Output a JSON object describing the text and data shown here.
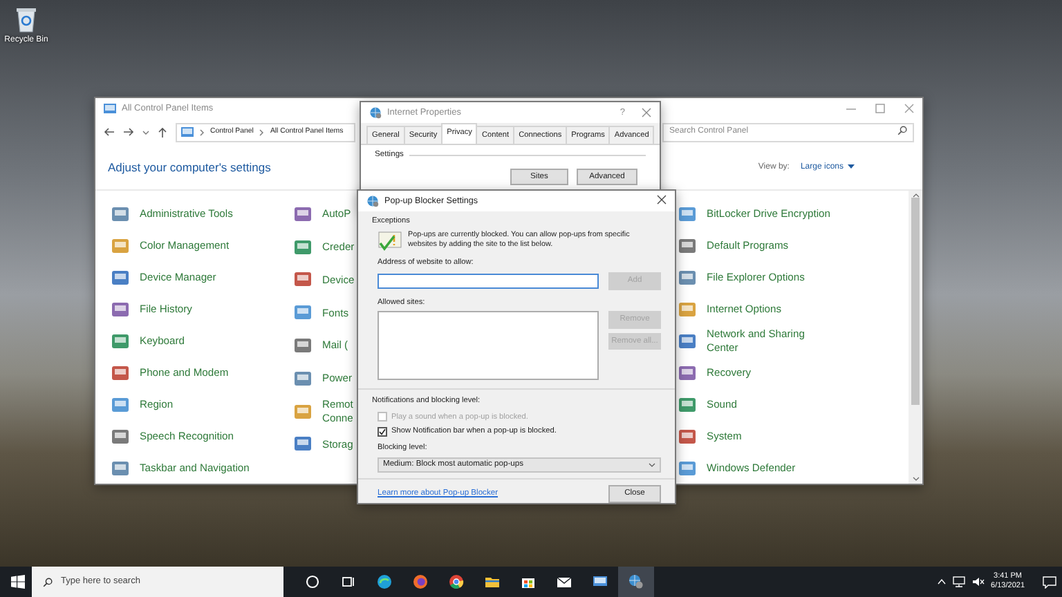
{
  "desktop_icons": [
    {
      "label": "Recycle Bin"
    }
  ],
  "control_panel": {
    "title": "All Control Panel Items",
    "breadcrumb": [
      "Control Panel",
      "All Control Panel Items"
    ],
    "search": {
      "placeholder": "Search Control Panel"
    },
    "heading": "Adjust your computer's settings",
    "view_by": {
      "label": "View by:",
      "value": "Large icons"
    },
    "columns": [
      [
        "Administrative Tools",
        "Color Management",
        "Device Manager",
        "File History",
        "Keyboard",
        "Phone and Modem",
        "Region",
        "Speech Recognition",
        "Taskbar and Navigation"
      ],
      [
        "AutoP",
        "Creder",
        "Device",
        "Fonts",
        "Mail (",
        "Power",
        "Remot\nConne",
        "Storag"
      ],
      [
        "BitLocker Drive Encryption",
        "Default Programs",
        "File Explorer Options",
        "Internet Options",
        "Network and Sharing\nCenter",
        "Recovery",
        "Sound",
        "System",
        "Windows Defender"
      ]
    ]
  },
  "internet_properties": {
    "title": "Internet Properties",
    "help_button": "?",
    "tabs": [
      {
        "label": "General",
        "selected": false
      },
      {
        "label": "Security",
        "selected": false
      },
      {
        "label": "Privacy",
        "selected": true
      },
      {
        "label": "Content",
        "selected": false
      },
      {
        "label": "Connections",
        "selected": false
      },
      {
        "label": "Programs",
        "selected": false
      },
      {
        "label": "Advanced",
        "selected": false
      }
    ],
    "section": "Settings",
    "buttons": [
      "Sites",
      "Advanced"
    ]
  },
  "popup_blocker": {
    "title": "Pop-up Blocker Settings",
    "exceptions_label": "Exceptions",
    "info": "Pop-ups are currently blocked.  You can allow pop-ups from specific websites by adding the site to the list below.",
    "address_label": "Address of website to allow:",
    "add_button": {
      "label": "Add",
      "disabled": true
    },
    "allowed_label": "Allowed sites:",
    "list_buttons": [
      {
        "label": "Remove",
        "disabled": true
      },
      {
        "label": "Remove all...",
        "disabled": true
      }
    ],
    "notifications_label": "Notifications and blocking level:",
    "options": [
      {
        "label": "Play a sound when a pop-up is blocked.",
        "checked": false,
        "disabled": true
      },
      {
        "label": "Show Notification bar when a pop-up is blocked.",
        "checked": true,
        "disabled": false
      }
    ],
    "blocking_level_label": "Blocking level:",
    "blocking_level": "Medium: Block most automatic pop-ups",
    "link": "Learn more about Pop-up Blocker",
    "close_button": "Close"
  },
  "taskbar": {
    "search_placeholder": "Type here to search",
    "apps": [
      {
        "kind": "cortana",
        "selected": false
      },
      {
        "kind": "task-view",
        "selected": false
      },
      {
        "kind": "edge",
        "selected": false
      },
      {
        "kind": "firefox",
        "selected": false
      },
      {
        "kind": "chrome",
        "selected": false
      },
      {
        "kind": "explorer",
        "selected": false
      },
      {
        "kind": "store",
        "selected": false
      },
      {
        "kind": "mail",
        "selected": false
      },
      {
        "kind": "control-panel",
        "selected": false
      },
      {
        "kind": "internet-properties",
        "selected": true
      }
    ],
    "time": "3:41 PM",
    "date": "6/13/2021"
  }
}
